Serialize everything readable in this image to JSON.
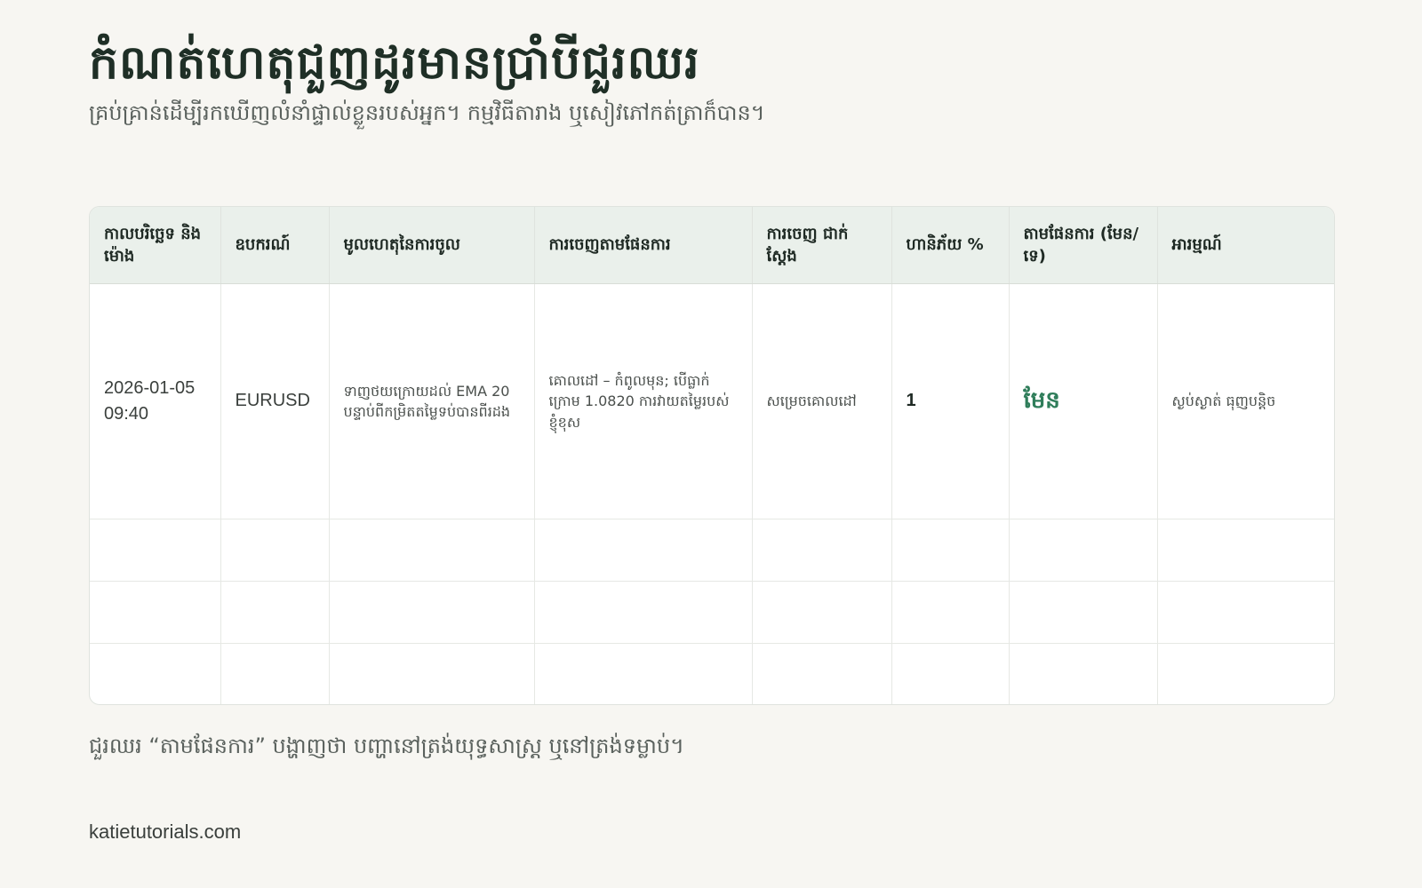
{
  "header": {
    "title": "កំណត់ហេតុជួញដូរមានប្រាំបីជួរឈរ",
    "subtitle": "គ្រប់គ្រាន់ដើម្បីរកឃើញលំនាំផ្ទាល់ខ្លួនរបស់អ្នក។ កម្មវិធីតារាង ឬសៀវភៅកត់ត្រាក៏បាន។"
  },
  "table": {
    "columns": [
      "កាលបរិច្ឆេទ និងម៉ោង",
      "ឧបករណ៍",
      "មូលហេតុនៃការចូល",
      "ការចេញតាមផែនការ",
      "ការចេញ ជាក់ស្តែង",
      "ហានិភ័យ %",
      "តាមផែនការ (មែន/ទេ)",
      "អារម្មណ៍"
    ],
    "rows": [
      [
        "2026-01-05 09:40",
        "EURUSD",
        "ទាញថយក្រោយដល់ EMA 20 បន្ទាប់ពីកម្រិតតម្លៃទប់បានពីរដង",
        "គោលដៅ – កំពូលមុន; បើធ្លាក់ក្រោម 1.0820 ការវាយតម្លៃរបស់ខ្ញុំខុស",
        "សម្រេចគោលដៅ",
        "1",
        "មែន",
        "ស្ងប់ស្ងាត់ ធុញបន្តិច"
      ],
      [
        "",
        "",
        "",
        "",
        "",
        "",
        "",
        ""
      ],
      [
        "",
        "",
        "",
        "",
        "",
        "",
        "",
        ""
      ],
      [
        "",
        "",
        "",
        "",
        "",
        "",
        "",
        ""
      ]
    ]
  },
  "footnote": "ជួរឈរ “តាមផែនការ” បង្ហាញថា បញ្ហានៅត្រង់យុទ្ធសាស្ត្រ ឬនៅត្រង់ទម្លាប់។",
  "footer": {
    "site": "katietutorials.com"
  },
  "colors": {
    "background": "#f7f6f2",
    "header_row": "#eaf0eb",
    "plan_yes": "#2f7d5a"
  }
}
